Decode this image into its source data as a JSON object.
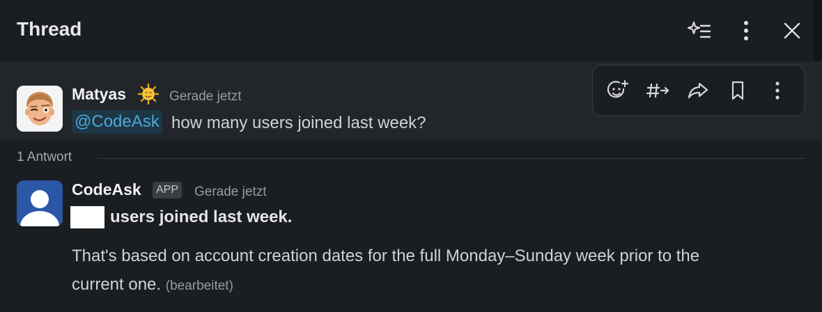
{
  "header": {
    "title": "Thread",
    "icons": [
      "sparkle-list-icon",
      "more-vertical-icon",
      "close-icon"
    ]
  },
  "parent_message": {
    "sender": "Matyas",
    "status_emoji": "sun-emoji",
    "timestamp": "Gerade jetzt",
    "mention": "@CodeAsk",
    "text": "how many users joined last week?"
  },
  "actions": [
    "add-reaction-icon",
    "forward-to-channel-icon",
    "share-icon",
    "bookmark-icon",
    "more-vertical-icon"
  ],
  "replies": {
    "count_label": "1 Antwort"
  },
  "reply": {
    "sender": "CodeAsk",
    "badge": "APP",
    "timestamp": "Gerade jetzt",
    "bold_text": "users joined last week.",
    "body_line1": "That's based on account creation dates for the full Monday–Sunday week prior to the",
    "body_line2": "current one.",
    "edited_label": "(bearbeitet)"
  }
}
